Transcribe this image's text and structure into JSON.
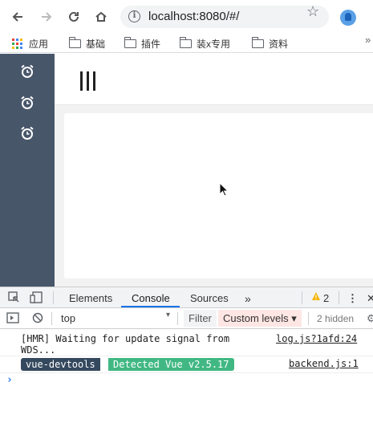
{
  "browser": {
    "url": "localhost:8080/#/",
    "bookmarks": [
      {
        "label": "应用",
        "icon": "apps-grid-icon"
      },
      {
        "label": "基础",
        "icon": "folder-icon"
      },
      {
        "label": "插件",
        "icon": "folder-icon"
      },
      {
        "label": "装x专用",
        "icon": "folder-icon"
      },
      {
        "label": "资料",
        "icon": "folder-icon"
      }
    ],
    "bookmarks_overflow": "»"
  },
  "app": {
    "sidebar_icons": [
      "alarm-clock-icon",
      "alarm-clock-icon",
      "alarm-clock-icon"
    ],
    "sidebar_color": "#48566a"
  },
  "devtools": {
    "tabs": [
      "Elements",
      "Console",
      "Sources"
    ],
    "active_tab": "Console",
    "more_tabs": "»",
    "warning_count": "2",
    "context": "top",
    "filter_label": "Filter",
    "levels_label": "Custom levels ▾",
    "hidden_label": "2 hidden",
    "logs": [
      {
        "message_line1": "[HMR] Waiting for update signal from",
        "message_line2": "WDS...",
        "source": "log.js?1afd:24"
      },
      {
        "badge_left": "vue-devtools",
        "badge_right": "Detected Vue v2.5.17",
        "source": "backend.js:1"
      }
    ],
    "prompt": "›",
    "colors": {
      "accent": "#1a73e8",
      "vue_green": "#41b883",
      "vue_dark": "#35495e",
      "warning": "#f4b400"
    }
  }
}
